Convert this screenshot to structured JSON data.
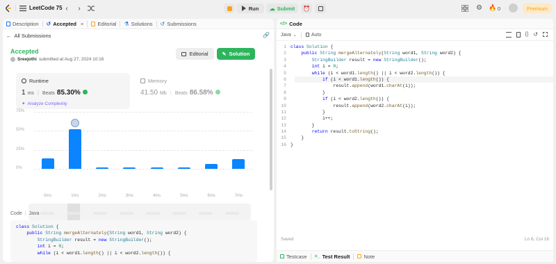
{
  "topbar": {
    "title": "LeetCode 75",
    "run_label": "Run",
    "submit_label": "Submit",
    "fire_count": "0",
    "premium_label": "Premium"
  },
  "left_tabs": [
    {
      "label": "Description"
    },
    {
      "label": "Accepted"
    },
    {
      "label": "Editorial"
    },
    {
      "label": "Solutions"
    },
    {
      "label": "Submissions"
    }
  ],
  "result": {
    "back_label": "All Submissions",
    "status": "Accepted",
    "user": "Sreejothi",
    "submitted_at": "submitted at Aug 27, 2024 10:16",
    "editorial_btn": "Editorial",
    "solution_btn": "Solution"
  },
  "runtime": {
    "label": "Runtime",
    "value": "1",
    "unit": "ms",
    "beats_label": "Beats",
    "beats_value": "85.30%",
    "analyze_label": "Analyze Complexity"
  },
  "memory": {
    "label": "Memory",
    "value": "41.50",
    "unit": "Mb",
    "beats_label": "Beats",
    "beats_value": "86.58%"
  },
  "chart_data": {
    "type": "bar",
    "y_ticks": [
      "75%",
      "50%",
      "25%",
      "0%"
    ],
    "ylim": [
      0,
      75
    ],
    "categories": [
      "0ms",
      "1ms",
      "2ms",
      "3ms",
      "4ms",
      "5ms",
      "6ms",
      "7ms"
    ],
    "values": [
      14,
      52,
      2,
      2,
      2,
      2,
      6,
      13
    ],
    "bar_color": "#0a84ff",
    "highlight_category": "1ms"
  },
  "code_section": {
    "code_label": "Code",
    "lang_label": "Java",
    "lines": [
      "class Solution {",
      "    public String mergeAlternately(String word1, String word2) {",
      "        StringBuilder result = new StringBuilder();",
      "        int i = 0;",
      "        while (i < word1.length() || i < word2.length()) {"
    ]
  },
  "editor": {
    "title": "Code",
    "language": "Java",
    "auto_label": "Auto",
    "saved_label": "Saved",
    "cursor_pos": "Ln 6, Col 16",
    "lines": [
      "class Solution {",
      "    public String mergeAlternately(String word1, String word2) {",
      "        StringBuilder result = new StringBuilder();",
      "        int i = 0;",
      "        while (i < word1.length() || i < word2.length()) {",
      "            if (i < word1.length()) {",
      "                result.append(word1.charAt(i));",
      "            }",
      "            if (i < word2.length()) {",
      "                result.append(word2.charAt(i));",
      "            }",
      "            i++;",
      "        }",
      "        return result.toString();",
      "    }",
      "}"
    ]
  },
  "bottom_tabs": [
    {
      "label": "Testcase"
    },
    {
      "label": "Test Result"
    },
    {
      "label": "Note"
    }
  ],
  "colors": {
    "accepted_green": "#2db55d",
    "accent_blue": "#0a84ff",
    "premium_orange": "#ffa116"
  }
}
